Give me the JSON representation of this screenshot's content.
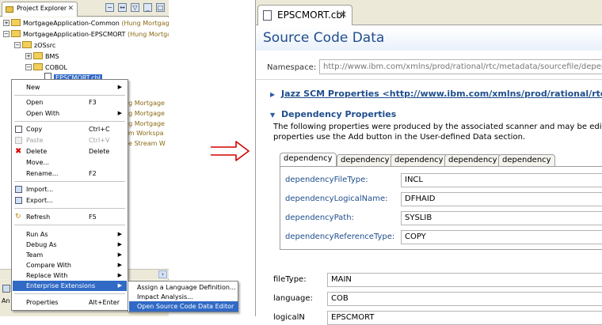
{
  "project_explorer": {
    "tab_label": "Project Explorer",
    "tree": [
      {
        "label": "MortgageApplication-Common",
        "hint": "(Hung Mortgage S"
      },
      {
        "label": "MortgageApplication-EPSCMORT",
        "hint": "(Hung Mortgage"
      },
      {
        "label": "zOSsrc",
        "hint": ""
      },
      {
        "label": "BMS",
        "hint": ""
      },
      {
        "label": "COBOL",
        "hint": ""
      },
      {
        "label": "EPSCMORT.cbl",
        "hint": ""
      }
    ],
    "side_hints": [
      "ung Mortgage",
      "ung Mortgage",
      "ung Mortgage",
      "eam Workspa",
      "age Stream W"
    ],
    "bottom_text": "An"
  },
  "context_menu": {
    "items": [
      {
        "label": "New",
        "shortcut": "",
        "submenu": true,
        "disabled": false
      },
      {
        "label": "Open",
        "shortcut": "F3",
        "submenu": false,
        "disabled": false
      },
      {
        "label": "Open With",
        "shortcut": "",
        "submenu": true,
        "disabled": false
      },
      {
        "label": "Copy",
        "shortcut": "Ctrl+C",
        "submenu": false,
        "disabled": false
      },
      {
        "label": "Paste",
        "shortcut": "Ctrl+V",
        "submenu": false,
        "disabled": true
      },
      {
        "label": "Delete",
        "shortcut": "Delete",
        "submenu": false,
        "disabled": false
      },
      {
        "label": "Move...",
        "shortcut": "",
        "submenu": false,
        "disabled": false
      },
      {
        "label": "Rename...",
        "shortcut": "F2",
        "submenu": false,
        "disabled": false
      },
      {
        "label": "Import...",
        "shortcut": "",
        "submenu": false,
        "disabled": false
      },
      {
        "label": "Export...",
        "shortcut": "",
        "submenu": false,
        "disabled": false
      },
      {
        "label": "Refresh",
        "shortcut": "F5",
        "submenu": false,
        "disabled": false
      },
      {
        "label": "Run As",
        "shortcut": "",
        "submenu": true,
        "disabled": false
      },
      {
        "label": "Debug As",
        "shortcut": "",
        "submenu": true,
        "disabled": false
      },
      {
        "label": "Team",
        "shortcut": "",
        "submenu": true,
        "disabled": false
      },
      {
        "label": "Compare With",
        "shortcut": "",
        "submenu": true,
        "disabled": false
      },
      {
        "label": "Replace With",
        "shortcut": "",
        "submenu": true,
        "disabled": false
      },
      {
        "label": "Enterprise Extensions",
        "shortcut": "",
        "submenu": true,
        "disabled": false
      },
      {
        "label": "Properties",
        "shortcut": "Alt+Enter",
        "submenu": false,
        "disabled": false
      }
    ]
  },
  "submenu": {
    "items": [
      {
        "label": "Assign a Language Definition..."
      },
      {
        "label": "Impact Analysis..."
      },
      {
        "label": "Open Source Code Data Editor"
      }
    ]
  },
  "editor": {
    "tab_label": "EPSCMORT.cbl",
    "title": "Source Code Data",
    "namespace_label": "Namespace:",
    "namespace_value": "http://www.ibm.com/xmlns/prod/rational/rtc/metadata/sourcefile/depend",
    "section_scm": "Jazz SCM Properties <http://www.ibm.com/xmlns/prod/rational/rtc/m",
    "section_dep": "Dependency Properties",
    "desc_line1": "The following properties were produced by the associated scanner and may be edited.",
    "desc_line2": "properties use the Add button in the User-defined Data section.",
    "dep_tabs": [
      "dependency",
      "dependency",
      "dependency",
      "dependency",
      "dependency"
    ],
    "dep_props": [
      {
        "label": "dependencyFileType:",
        "value": "INCL"
      },
      {
        "label": "dependencyLogicalName:",
        "value": "DFHAID"
      },
      {
        "label": "dependencyPath:",
        "value": "SYSLIB"
      },
      {
        "label": "dependencyReferenceType:",
        "value": "COPY"
      }
    ],
    "fields": [
      {
        "label": "fileType:",
        "value": "MAIN"
      },
      {
        "label": "language:",
        "value": "COB"
      },
      {
        "label": "logicalN",
        "value": "EPSCMORT"
      }
    ]
  },
  "colors": {
    "selection": "#316ac5",
    "section_title": "#1f4e8c",
    "arrow": "#d40000"
  }
}
